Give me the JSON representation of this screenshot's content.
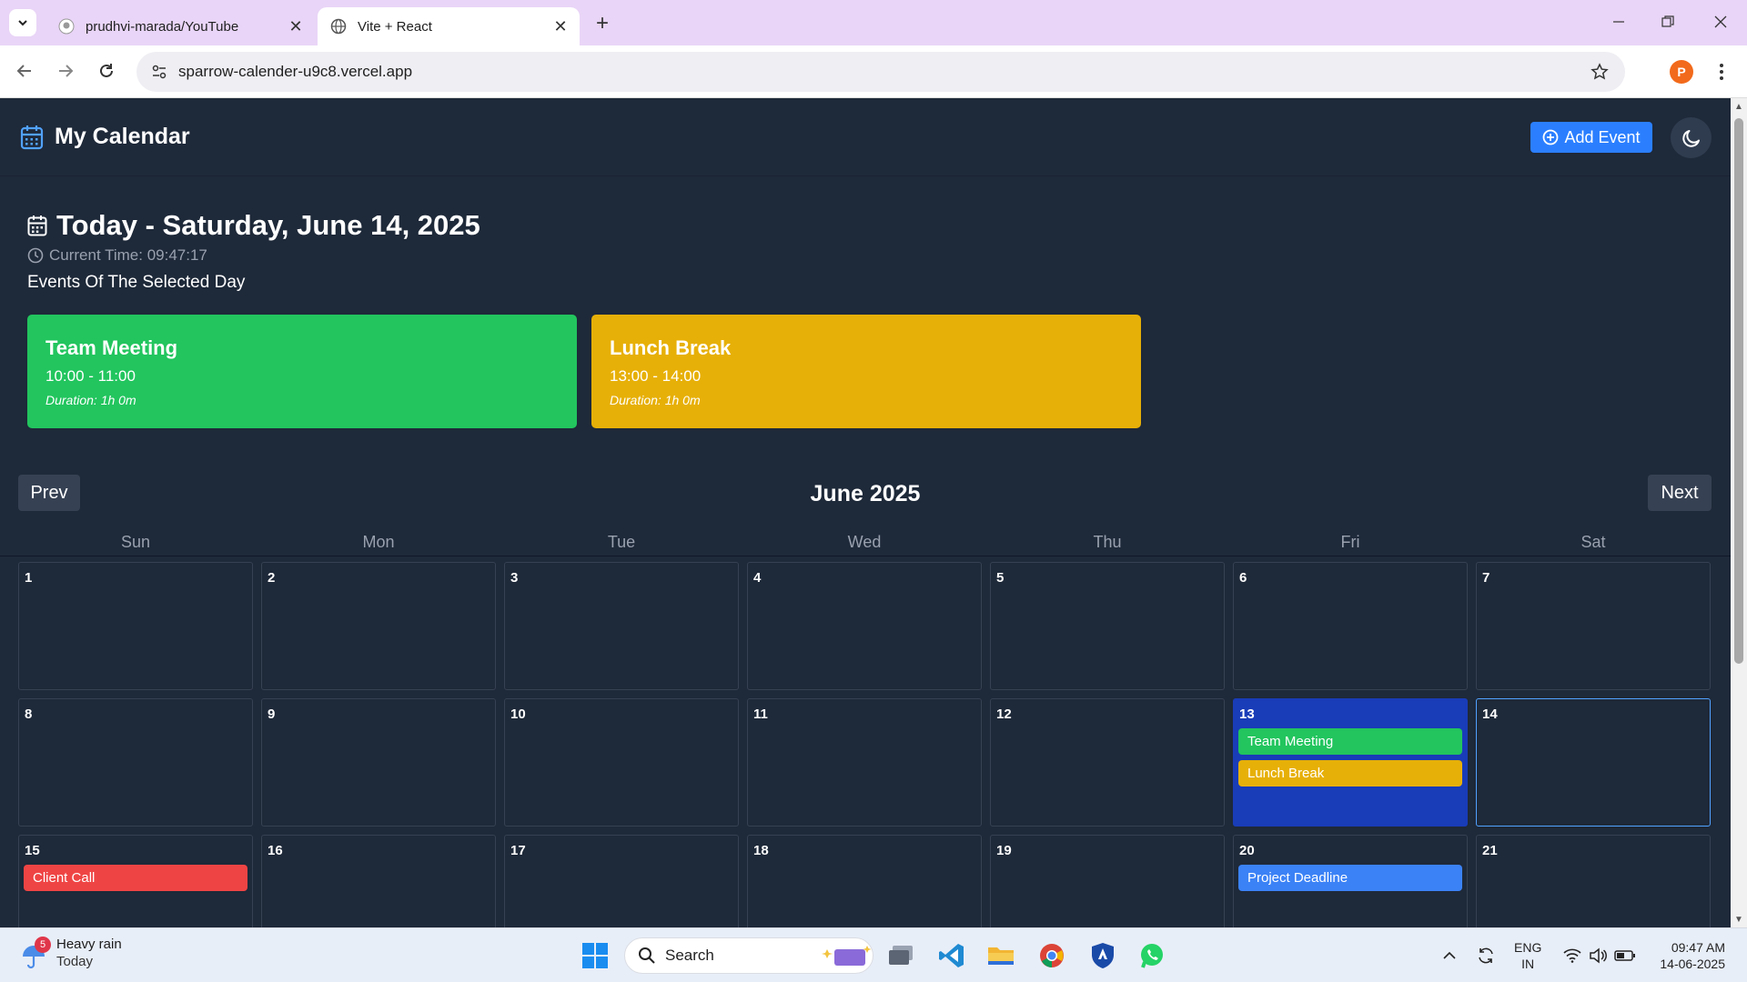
{
  "browser": {
    "tabs": [
      {
        "title": "prudhvi-marada/YouTube",
        "active": false
      },
      {
        "title": "Vite + React",
        "active": true
      }
    ],
    "url": "sparrow-calender-u9c8.vercel.app",
    "profile_initial": "P"
  },
  "app": {
    "title": "My Calendar",
    "add_event_label": "Add Event",
    "today": {
      "heading": "Today - Saturday, June 14, 2025",
      "current_time": "Current Time: 09:47:17",
      "events_label": "Events Of The Selected Day",
      "events": [
        {
          "title": "Team Meeting",
          "time": "10:00 - 11:00",
          "duration": "Duration: 1h 0m",
          "color": "#22c55e"
        },
        {
          "title": "Lunch Break",
          "time": "13:00 - 14:00",
          "duration": "Duration: 1h 0m",
          "color": "#e7b008"
        }
      ]
    },
    "calendar": {
      "month_label": "June 2025",
      "prev_label": "Prev",
      "next_label": "Next",
      "weekdays": [
        "Sun",
        "Mon",
        "Tue",
        "Wed",
        "Thu",
        "Fri",
        "Sat"
      ],
      "selected_day": "13",
      "today_day": "14",
      "weeks": [
        [
          {
            "day": "1",
            "events": []
          },
          {
            "day": "2",
            "events": []
          },
          {
            "day": "3",
            "events": []
          },
          {
            "day": "4",
            "events": []
          },
          {
            "day": "5",
            "events": []
          },
          {
            "day": "6",
            "events": []
          },
          {
            "day": "7",
            "events": []
          }
        ],
        [
          {
            "day": "8",
            "events": []
          },
          {
            "day": "9",
            "events": []
          },
          {
            "day": "10",
            "events": []
          },
          {
            "day": "11",
            "events": []
          },
          {
            "day": "12",
            "events": []
          },
          {
            "day": "13",
            "events": [
              {
                "title": "Team Meeting",
                "color": "#22c55e"
              },
              {
                "title": "Lunch Break",
                "color": "#e7b008"
              }
            ]
          },
          {
            "day": "14",
            "events": []
          }
        ],
        [
          {
            "day": "15",
            "events": [
              {
                "title": "Client Call",
                "color": "#ef4444"
              }
            ]
          },
          {
            "day": "16",
            "events": []
          },
          {
            "day": "17",
            "events": []
          },
          {
            "day": "18",
            "events": []
          },
          {
            "day": "19",
            "events": []
          },
          {
            "day": "20",
            "events": [
              {
                "title": "Project Deadline",
                "color": "#3b82f6"
              }
            ]
          },
          {
            "day": "21",
            "events": []
          }
        ]
      ]
    }
  },
  "taskbar": {
    "weather_title": "Heavy rain",
    "weather_sub": "Today",
    "weather_badge": "5",
    "search_label": "Search",
    "lang_top": "ENG",
    "lang_bottom": "IN",
    "time": "09:47 AM",
    "date": "14-06-2025"
  }
}
